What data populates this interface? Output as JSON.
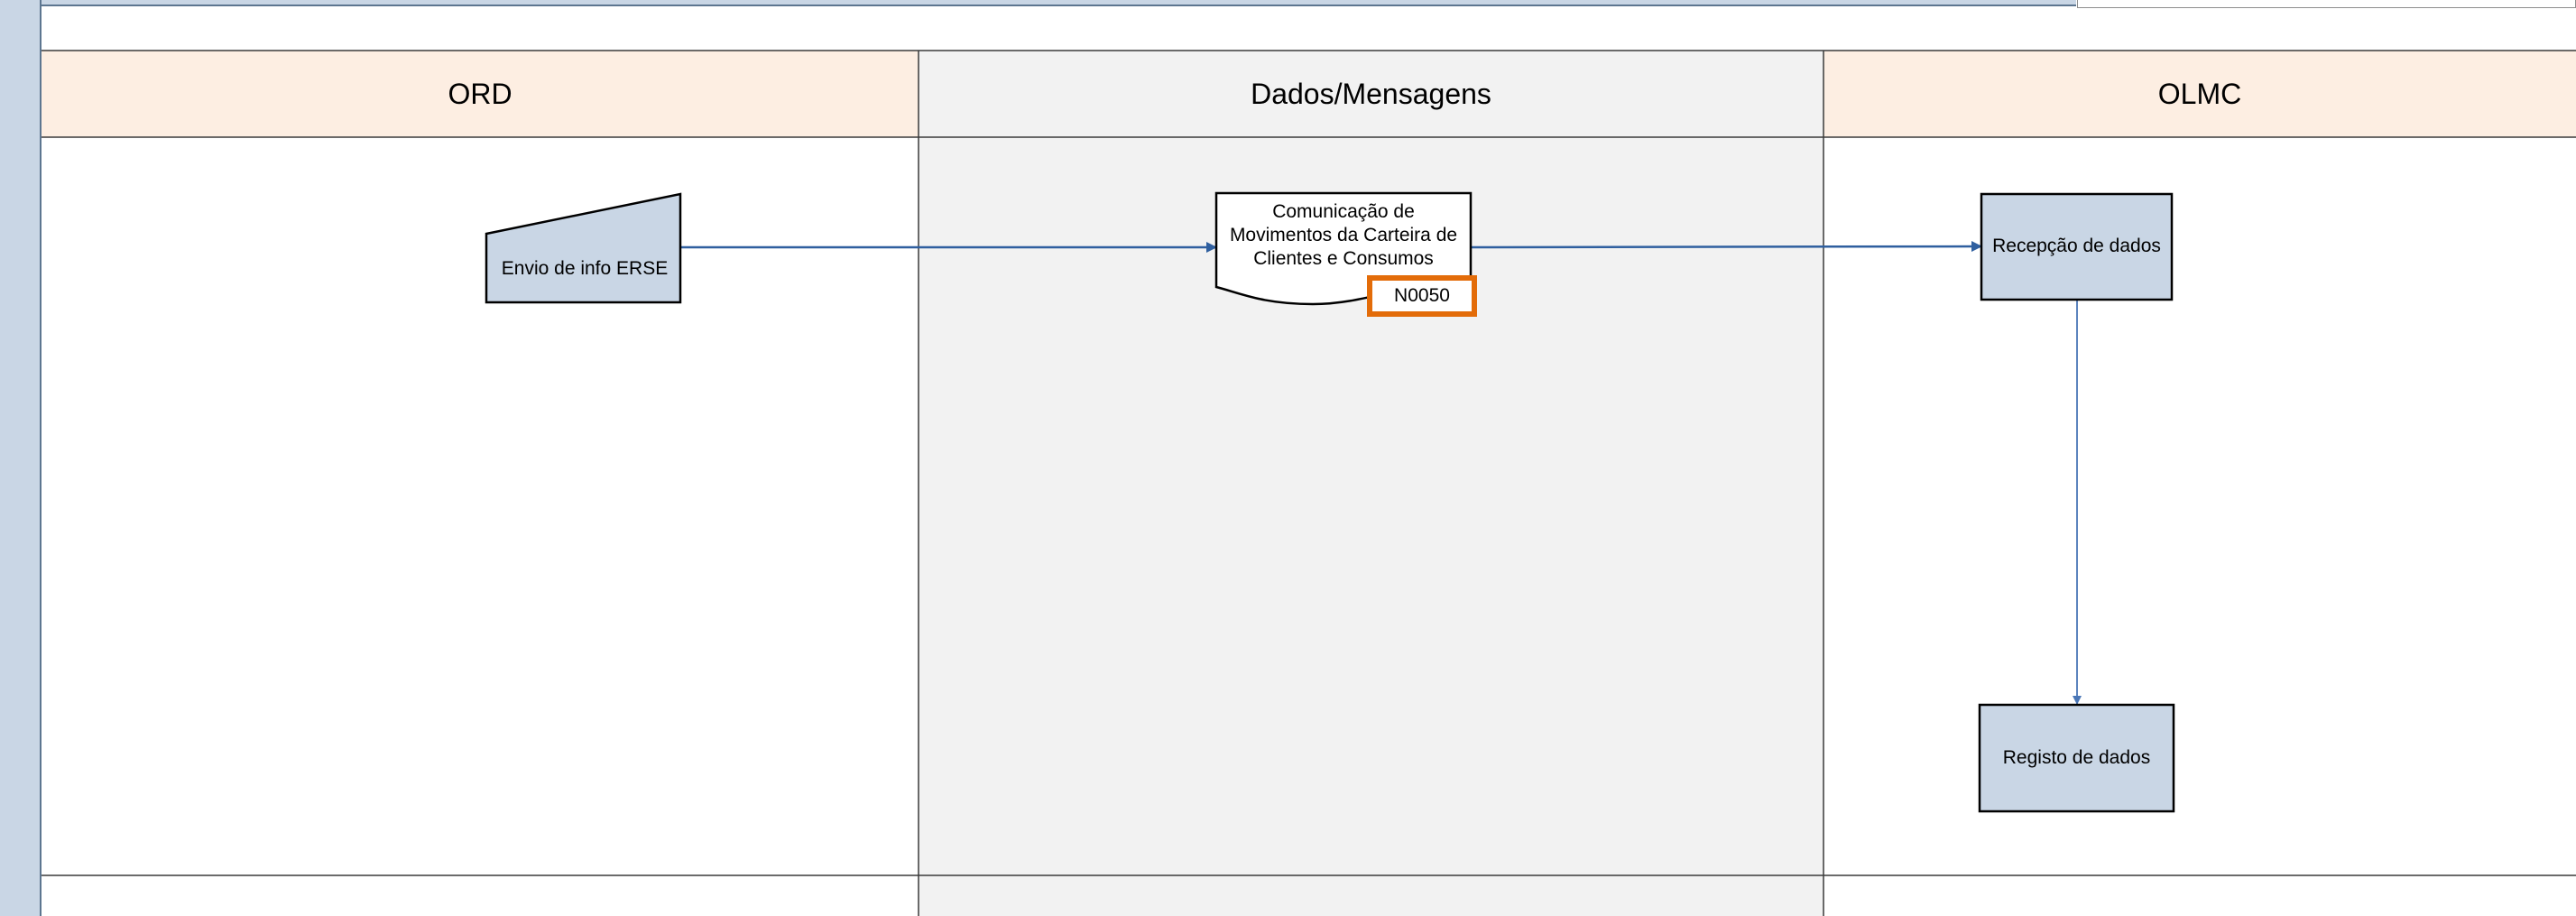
{
  "lanes": {
    "ord": "ORD",
    "dados": "Dados/Mensagens",
    "olmc": "OLMC"
  },
  "nodes": {
    "envio": "Envio de info ERSE",
    "comunicacao": "Comunicação de Movimentos da Carteira de Clientes e Consumos",
    "code": "N0050",
    "recepcao": "Recepção de dados",
    "registo": "Registo de dados"
  },
  "colors": {
    "lane_header": "#fdeee2",
    "lane_middle": "#f2f2f2",
    "process_fill": "#c9d6e5",
    "connector": "#2f5f9f",
    "highlight": "#e36c09"
  }
}
